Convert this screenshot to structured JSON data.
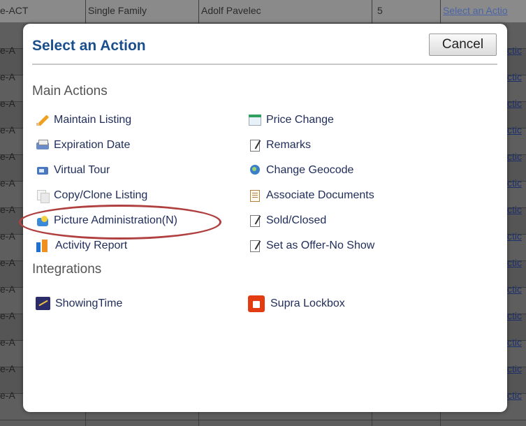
{
  "background": {
    "top_row": {
      "left_text": "e-ACT",
      "property_type": "Single Family",
      "agent": "Adolf Pavelec",
      "count": "5",
      "action_link": "Select an Actio"
    },
    "left_fragment": "e-A",
    "right_fragment": "ctic"
  },
  "modal": {
    "title": "Select an Action",
    "cancel_label": "Cancel",
    "main_actions_title": "Main Actions",
    "integrations_title": "Integrations",
    "left_actions": [
      {
        "label": "Maintain Listing",
        "icon": "pencil-icon"
      },
      {
        "label": "Expiration Date",
        "icon": "printer-icon"
      },
      {
        "label": "Virtual Tour",
        "icon": "virtual-tour-icon"
      },
      {
        "label": "Copy/Clone Listing",
        "icon": "copy-icon"
      },
      {
        "label": "Picture Administration(N)",
        "icon": "picture-icon"
      },
      {
        "label": "Activity Report",
        "icon": "report-icon"
      }
    ],
    "right_actions": [
      {
        "label": "Price Change",
        "icon": "calendar-icon"
      },
      {
        "label": "Remarks",
        "icon": "note-icon"
      },
      {
        "label": "Change Geocode",
        "icon": "geocode-icon"
      },
      {
        "label": "Associate Documents",
        "icon": "document-icon"
      },
      {
        "label": "Sold/Closed",
        "icon": "note-icon"
      },
      {
        "label": "Set as Offer-No Show",
        "icon": "note-icon"
      }
    ],
    "integrations": [
      {
        "label": "ShowingTime",
        "icon": "showingtime-icon"
      },
      {
        "label": "Supra Lockbox",
        "icon": "supra-lockbox-icon"
      }
    ],
    "annotation_color": "#b04040"
  }
}
